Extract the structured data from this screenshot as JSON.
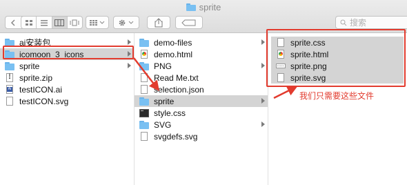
{
  "window": {
    "title": "sprite"
  },
  "toolbar": {
    "back_icon": "chevron-left-icon",
    "forward_icon": "chevron-right-icon",
    "view_modes": [
      "icon-view-icon",
      "list-view-icon",
      "column-view-icon",
      "coverflow-view-icon"
    ],
    "active_view": "column-view-icon",
    "arrange_icon": "grid-arrange-icon",
    "action_icon": "gear-icon",
    "share_icon": "share-icon",
    "tag_icon": "tag-icon",
    "search_placeholder": "搜索"
  },
  "col1": {
    "items": [
      {
        "name": "ai安装包",
        "icon": "folder-icon",
        "has_children": true,
        "selected": false
      },
      {
        "name": "icomoon_3_icons",
        "icon": "folder-icon",
        "has_children": true,
        "selected": true
      },
      {
        "name": "sprite",
        "icon": "folder-icon",
        "has_children": true,
        "selected": false
      },
      {
        "name": "sprite.zip",
        "icon": "zip-file-icon",
        "has_children": false,
        "selected": false
      },
      {
        "name": "testICON.ai",
        "icon": "ai-file-icon",
        "has_children": false,
        "selected": false
      },
      {
        "name": "testICON.svg",
        "icon": "document-icon",
        "has_children": false,
        "selected": false
      }
    ]
  },
  "col2": {
    "items": [
      {
        "name": "demo-files",
        "icon": "folder-icon",
        "has_children": true,
        "selected": false
      },
      {
        "name": "demo.html",
        "icon": "html-file-icon",
        "has_children": false,
        "selected": false
      },
      {
        "name": "PNG",
        "icon": "folder-icon",
        "has_children": true,
        "selected": false
      },
      {
        "name": "Read Me.txt",
        "icon": "document-icon",
        "has_children": false,
        "selected": false
      },
      {
        "name": "selection.json",
        "icon": "document-icon",
        "has_children": false,
        "selected": false
      },
      {
        "name": "sprite",
        "icon": "folder-icon",
        "has_children": true,
        "selected": true
      },
      {
        "name": "style.css",
        "icon": "terminal-file-icon",
        "has_children": false,
        "selected": false
      },
      {
        "name": "SVG",
        "icon": "folder-icon",
        "has_children": true,
        "selected": false
      },
      {
        "name": "svgdefs.svg",
        "icon": "document-icon",
        "has_children": false,
        "selected": false
      }
    ]
  },
  "col3": {
    "items": [
      {
        "name": "sprite.css",
        "icon": "document-icon",
        "selected": true
      },
      {
        "name": "sprite.html",
        "icon": "html-file-icon",
        "selected": true
      },
      {
        "name": "sprite.png",
        "icon": "png-file-icon",
        "selected": true
      },
      {
        "name": "sprite.svg",
        "icon": "document-icon",
        "selected": true
      }
    ]
  },
  "annotation": {
    "note": "我们只需要这些文件",
    "color": "#e23b2e"
  },
  "colors": {
    "selection": "#d4d4d4",
    "folder": "#79c0f2",
    "annotation_red": "#e23b2e"
  }
}
